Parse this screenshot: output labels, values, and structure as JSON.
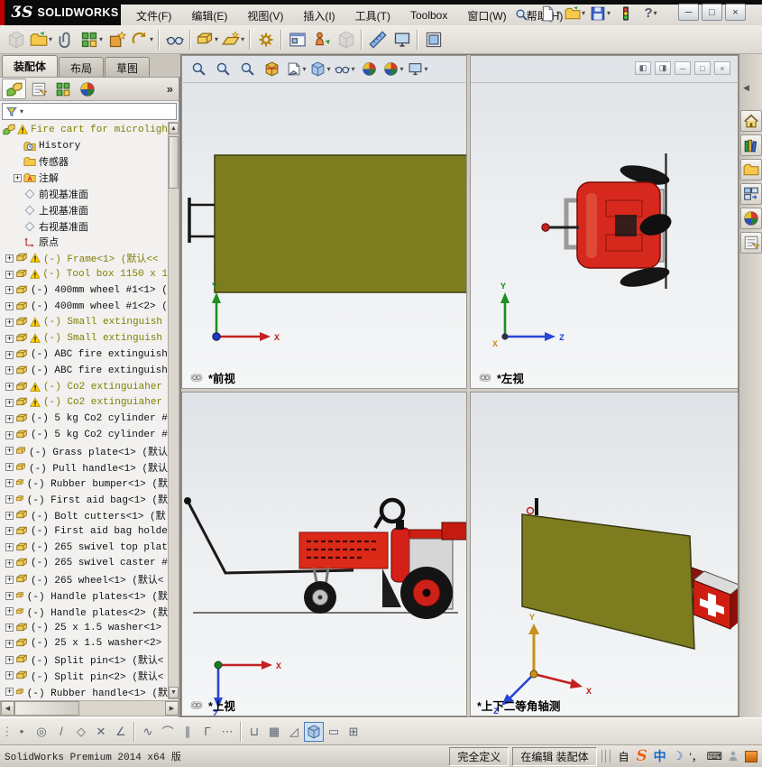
{
  "titlebar": {
    "logo_prefix": "ƷS",
    "logo_text": "SOLIDWORKS",
    "menus": [
      "文件(F)",
      "编辑(E)",
      "视图(V)",
      "插入(I)",
      "工具(T)",
      "Toolbox",
      "窗口(W)",
      "帮助(H)"
    ],
    "quick_toolbar": [
      {
        "name": "new-document",
        "dropdown": true
      },
      {
        "name": "open-document",
        "dropdown": true
      },
      {
        "name": "save-document",
        "dropdown": true
      },
      {
        "name": "rebuild-traffic-light",
        "dropdown": false
      },
      {
        "name": "help",
        "dropdown": true
      }
    ],
    "window_buttons": [
      "minimize",
      "maximize",
      "close"
    ]
  },
  "main_toolbar": [
    {
      "name": "insert-component",
      "disabled": true
    },
    {
      "name": "open-component",
      "dropdown": true
    },
    {
      "name": "mate"
    },
    {
      "name": "linear-component-pattern",
      "dropdown": true
    },
    {
      "name": "smart-fasteners"
    },
    {
      "name": "rotate-component",
      "dropdown": true
    },
    {
      "name": "sep"
    },
    {
      "name": "show-hidden-components"
    },
    {
      "name": "sep"
    },
    {
      "name": "assembly-features",
      "dropdown": true
    },
    {
      "name": "reference-geometry",
      "dropdown": true
    },
    {
      "name": "sep"
    },
    {
      "name": "new-motion-study"
    },
    {
      "name": "sep"
    },
    {
      "name": "bill-of-materials"
    },
    {
      "name": "exploded-view"
    },
    {
      "name": "explode-line-sketch",
      "disabled": true
    },
    {
      "name": "sep"
    },
    {
      "name": "instant3d"
    },
    {
      "name": "interference-detection"
    },
    {
      "name": "sep"
    },
    {
      "name": "take-snapshot"
    }
  ],
  "command_tabs": {
    "items": [
      "装配体",
      "布局",
      "草图"
    ],
    "active_index": 0
  },
  "panel_tabs": [
    "featuremanager",
    "propertymanager",
    "configurationmanager",
    "displaymanager"
  ],
  "panel_more": "»",
  "filter": {
    "value": ""
  },
  "tree": {
    "root_label": "Fire cart for microligh",
    "items": [
      {
        "icon": "history",
        "label": "History"
      },
      {
        "icon": "folder",
        "label": "传感器"
      },
      {
        "icon": "annotations",
        "label": "注解",
        "expand": true
      },
      {
        "icon": "plane",
        "label": "前视基准面"
      },
      {
        "icon": "plane",
        "label": "上视基准面"
      },
      {
        "icon": "plane",
        "label": "右视基准面"
      },
      {
        "icon": "origin",
        "label": "原点"
      },
      {
        "icon": "part",
        "label": "(-) Frame<1> (默认<<",
        "warn": true,
        "olive": true,
        "expand": true
      },
      {
        "icon": "part",
        "label": "(-) Tool box 1150 x 1",
        "warn": true,
        "olive": true,
        "expand": true
      },
      {
        "icon": "part",
        "label": "(-) 400mm wheel #1<1> (",
        "expand": true
      },
      {
        "icon": "part",
        "label": "(-) 400mm wheel #1<2> (",
        "expand": true
      },
      {
        "icon": "part",
        "label": "(-) Small extinguish",
        "warn": true,
        "olive": true,
        "expand": true
      },
      {
        "icon": "part",
        "label": "(-) Small extinguish",
        "warn": true,
        "olive": true,
        "expand": true
      },
      {
        "icon": "part",
        "label": "(-) ABC fire extinguish",
        "expand": true
      },
      {
        "icon": "part",
        "label": "(-) ABC fire extinguish",
        "expand": true
      },
      {
        "icon": "part",
        "label": "(-) Co2 extinguiaher",
        "warn": true,
        "olive": true,
        "expand": true
      },
      {
        "icon": "part",
        "label": "(-) Co2 extinguiaher",
        "warn": true,
        "olive": true,
        "expand": true
      },
      {
        "icon": "part",
        "label": "(-) 5 kg Co2 cylinder #",
        "expand": true
      },
      {
        "icon": "part",
        "label": "(-) 5 kg Co2 cylinder #",
        "expand": true
      },
      {
        "icon": "part",
        "label": "(-) Grass plate<1> (默认",
        "expand": true
      },
      {
        "icon": "part",
        "label": "(-) Pull handle<1> (默认",
        "expand": true
      },
      {
        "icon": "part",
        "label": "(-) Rubber bumper<1> (默",
        "expand": true
      },
      {
        "icon": "part",
        "label": "(-) First aid bag<1> (默",
        "expand": true
      },
      {
        "icon": "part",
        "label": "(-) Bolt cutters<1> (默",
        "expand": true
      },
      {
        "icon": "part",
        "label": "(-) First aid bag holde",
        "expand": true
      },
      {
        "icon": "part",
        "label": "(-) 265 swivel top plat",
        "expand": true
      },
      {
        "icon": "part",
        "label": "(-) 265 swivel caster #",
        "expand": true
      },
      {
        "icon": "part",
        "label": "(-) 265 wheel<1> (默认<",
        "expand": true
      },
      {
        "icon": "part",
        "label": "(-) Handle plates<1> (默",
        "expand": true
      },
      {
        "icon": "part",
        "label": "(-) Handle plates<2> (默",
        "expand": true
      },
      {
        "icon": "part",
        "label": "(-) 25 x 1.5 washer<1>",
        "expand": true
      },
      {
        "icon": "part",
        "label": "(-) 25 x 1.5 washer<2>",
        "expand": true
      },
      {
        "icon": "part",
        "label": "(-) Split pin<1> (默认<",
        "expand": true
      },
      {
        "icon": "part",
        "label": "(-) Split pin<2> (默认<",
        "expand": true
      },
      {
        "icon": "part",
        "label": "(-) Rubber handle<1> (默",
        "expand": true
      }
    ]
  },
  "hud_toolbar": [
    {
      "name": "zoom-to-fit"
    },
    {
      "name": "zoom-to-area"
    },
    {
      "name": "previous-view"
    },
    {
      "name": "section-view"
    },
    {
      "name": "view-orientation",
      "dropdown": true
    },
    {
      "name": "display-style",
      "dropdown": true
    },
    {
      "name": "hide-show-items",
      "dropdown": true
    },
    {
      "name": "edit-appearance"
    },
    {
      "name": "apply-scene",
      "dropdown": true
    },
    {
      "name": "view-settings",
      "dropdown": true
    }
  ],
  "viewport": {
    "views": [
      {
        "label": "*前视",
        "linked": true,
        "triad": [
          "Y",
          "X"
        ]
      },
      {
        "label": "*左视",
        "linked": true,
        "triad": [
          "Y",
          "Z",
          "X"
        ]
      },
      {
        "label": "*上视",
        "linked": true,
        "triad": [
          "X",
          "Z"
        ]
      },
      {
        "label": "*上下二等角轴测",
        "linked": false,
        "triad": [
          "Y",
          "X",
          "Z"
        ]
      }
    ],
    "window_controls": [
      "tile-left",
      "tile-right",
      "minimize-view",
      "restore-view",
      "close-view"
    ]
  },
  "taskpane": [
    "solidworks-resources",
    "design-library",
    "file-explorer",
    "view-palette",
    "appearances",
    "custom-properties"
  ],
  "snap_toolbar": [
    "grip",
    "point-snap",
    "center-snap",
    "line-snap",
    "polygon-snap",
    "intersection-snap",
    "angle-snap",
    "sep",
    "spline-snap",
    "tangent-snap",
    "parallel-snap",
    "corner-snap",
    "centerline-snap",
    "sep",
    "stretch-snap",
    "grid-snap",
    "angle45-snap",
    "view-single",
    "view-two",
    "view-four"
  ],
  "statusbar": {
    "product": "SolidWorks Premium 2014 x64 版",
    "define_status": "完全定义",
    "edit_status": "在编辑 装配体",
    "ime": [
      {
        "name": "custom-status",
        "text": "自"
      },
      {
        "name": "sogou-logo",
        "text": "S"
      },
      {
        "name": "chinese-mode",
        "text": "中"
      },
      {
        "name": "fullwidth-mode",
        "text": "☽"
      },
      {
        "name": "punctuation-mode",
        "text": "'，"
      },
      {
        "name": "soft-keyboard",
        "text": "⌨"
      },
      {
        "name": "ime-skin",
        "text": ""
      },
      {
        "name": "ime-toolbox",
        "text": ""
      }
    ]
  },
  "colors": {
    "accent_red": "#c00000",
    "olive_plate": "#7d7d20",
    "cart_red": "#da291c",
    "suppressed_text": "#7f7f00"
  }
}
